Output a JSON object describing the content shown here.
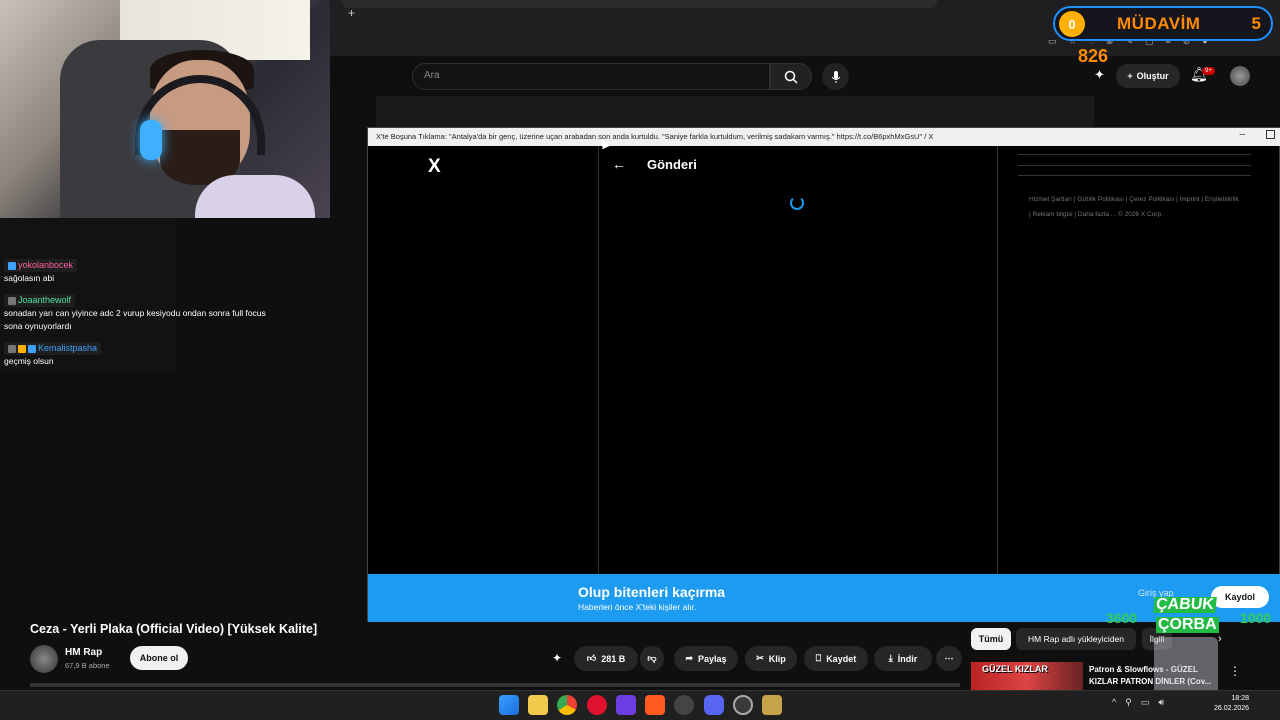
{
  "chat": {
    "messages": [
      {
        "user": "yokolanbocek",
        "color": "#ff5fa2",
        "text": "sağolasın abi"
      },
      {
        "user": "Joaanthewolf",
        "color": "#4de09b",
        "text": "sonadan yarı can yiyince adc 2 vurup kesiyodu ondan sonra full focus sona oynuyorlardı"
      },
      {
        "user": "Kemalistpasha",
        "color": "#3fa0ff",
        "text": "geçmiş olsun"
      }
    ]
  },
  "overlay": {
    "label": "MÜDAVİM",
    "left_value": "0",
    "right_value": "5",
    "counter": "826",
    "corba_title_1": "ÇABUK",
    "corba_title_2": "ÇORBA",
    "corba_left": "3600",
    "corba_right": "1000"
  },
  "youtube": {
    "search_placeholder": "Ara",
    "create_label": "Oluştur",
    "notif_badge": "9+",
    "video_title": "Ceza - Yerli Plaka (Official Video) [Yüksek Kalite]",
    "channel": "HM Rap",
    "subscribers": "67,9 B abone",
    "subscribe_label": "Abone ol",
    "like_count": "281 B",
    "share_label": "Paylaş",
    "clip_label": "Klip",
    "save_label": "Kaydet",
    "download_label": "İndir",
    "chips": [
      "Tümü",
      "HM Rap adlı yükleyiciden",
      "İlgili"
    ],
    "recommend_title": "Patron & Slowflows - GÜZEL KIZLAR PATRON DİNLER (Cov...",
    "recommend_thumb_text": "GÜZEL KIZLAR"
  },
  "popup": {
    "window_title": "X'te Boşuna Tıklama: \"Antalya'da bir genç, üzerine uçan arabadan son anda kurtuldu. \"Saniye farkla kurtuldum, verilmiş sadakam varmış.\" https://t.co/B6pxhMxGsU\" / X",
    "logo": "X",
    "header_title": "Gönderi",
    "footer_links": "Hizmet Şartları | Gizlilik Politikası | Çerez Politikası | Imprint | Erişilebilirlik | Reklam bilgisi | Daha fazla ... © 2026 X Corp.",
    "banner_title": "Olup bitenleri kaçırma",
    "banner_sub": "Haberleri önce X'teki kişiler alır.",
    "login_label": "Giriş yap",
    "signup_label": "Kaydol"
  },
  "taskbar": {
    "time": "18:28",
    "date": "26.02.2026"
  }
}
